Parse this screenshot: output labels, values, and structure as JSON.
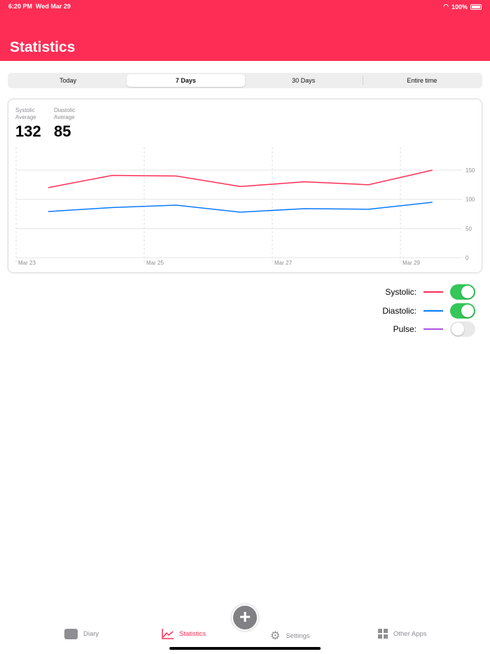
{
  "status_bar": {
    "time": "6:20 PM",
    "date": "Wed Mar 29",
    "battery": "100%"
  },
  "header": {
    "title": "Statistics"
  },
  "segments": [
    {
      "label": "Today",
      "active": false
    },
    {
      "label": "7 Days",
      "active": true
    },
    {
      "label": "30 Days",
      "active": false
    },
    {
      "label": "Entire time",
      "active": false
    }
  ],
  "averages": {
    "systolic_label": "Systolic Average",
    "systolic_value": "132",
    "diastolic_label": "Diastolic Average",
    "diastolic_value": "85"
  },
  "chart_data": {
    "type": "line",
    "x_ticks": [
      "Mar 23",
      "Mar 25",
      "Mar 27",
      "Mar 29"
    ],
    "x": [
      "Mar 23",
      "Mar 24",
      "Mar 25",
      "Mar 26",
      "Mar 27",
      "Mar 28",
      "Mar 29"
    ],
    "y_ticks": [
      0,
      50,
      100,
      150
    ],
    "ylim": [
      0,
      150
    ],
    "series": [
      {
        "name": "Systolic",
        "color": "#fe2d55",
        "values": [
          120,
          141,
          140,
          122,
          130,
          125,
          150
        ]
      },
      {
        "name": "Diastolic",
        "color": "#0a7aff",
        "values": [
          79,
          86,
          90,
          78,
          84,
          83,
          95
        ]
      }
    ]
  },
  "legend": [
    {
      "label": "Systolic:",
      "color": "#fe2d55",
      "on": true
    },
    {
      "label": "Diastolic:",
      "color": "#0a7aff",
      "on": true
    },
    {
      "label": "Pulse:",
      "color": "#af52de",
      "on": false
    }
  ],
  "tabbar": {
    "diary": "Diary",
    "statistics": "Statistics",
    "settings": "Settings",
    "other_apps": "Other Apps",
    "add": "+"
  }
}
